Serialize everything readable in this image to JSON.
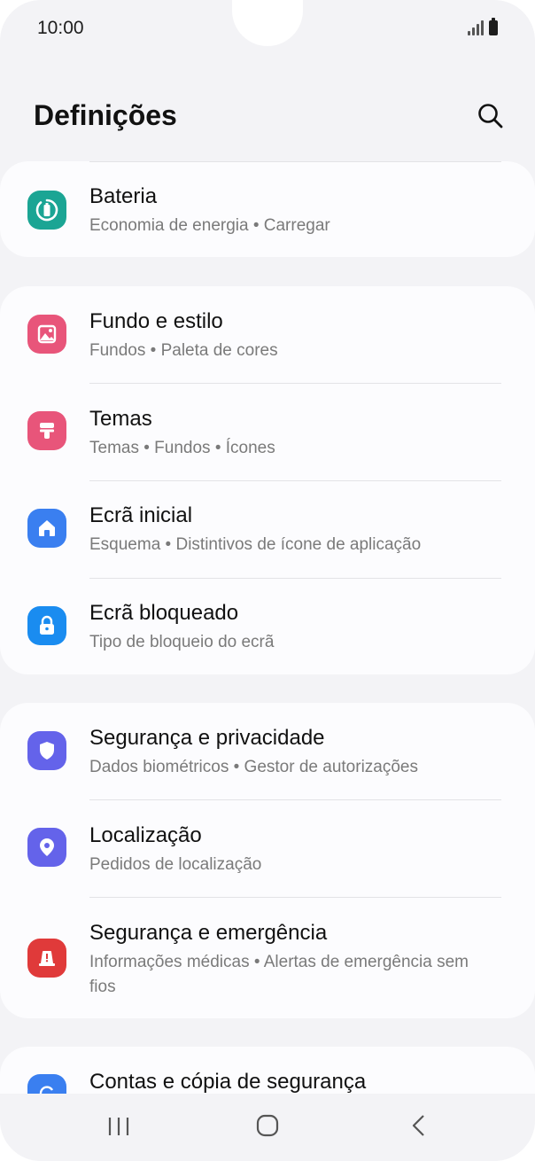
{
  "status_bar": {
    "time": "10:00"
  },
  "header": {
    "title": "Definições"
  },
  "items": [
    {
      "title": "Bateria",
      "subtitle": "Economia de energia  •  Carregar",
      "icon": "battery-icon",
      "color": "#1ba594"
    },
    {
      "title": "Fundo e estilo",
      "subtitle": "Fundos  •  Paleta de cores",
      "icon": "wallpaper-icon",
      "color": "#e8557a"
    },
    {
      "title": "Temas",
      "subtitle": "Temas  •  Fundos  •  Ícones",
      "icon": "themes-icon",
      "color": "#e8557a"
    },
    {
      "title": "Ecrã inicial",
      "subtitle": "Esquema  •  Distintivos de ícone de aplicação",
      "icon": "home-icon",
      "color": "#3a7ff0"
    },
    {
      "title": "Ecrã bloqueado",
      "subtitle": "Tipo de bloqueio do ecrã",
      "icon": "lock-icon",
      "color": "#1a8cf0"
    },
    {
      "title": "Segurança e privacidade",
      "subtitle": "Dados biométricos  •  Gestor de autorizações",
      "icon": "shield-icon",
      "color": "#6463ea"
    },
    {
      "title": "Localização",
      "subtitle": "Pedidos de localização",
      "icon": "location-icon",
      "color": "#6463ea"
    },
    {
      "title": "Segurança e emergência",
      "subtitle": "Informações médicas  •  Alertas de emergência sem fios",
      "icon": "emergency-icon",
      "color": "#e03a3a"
    },
    {
      "title": "Contas e cópia de segurança",
      "subtitle": "",
      "icon": "sync-icon",
      "color": "#3a7ff0"
    }
  ]
}
